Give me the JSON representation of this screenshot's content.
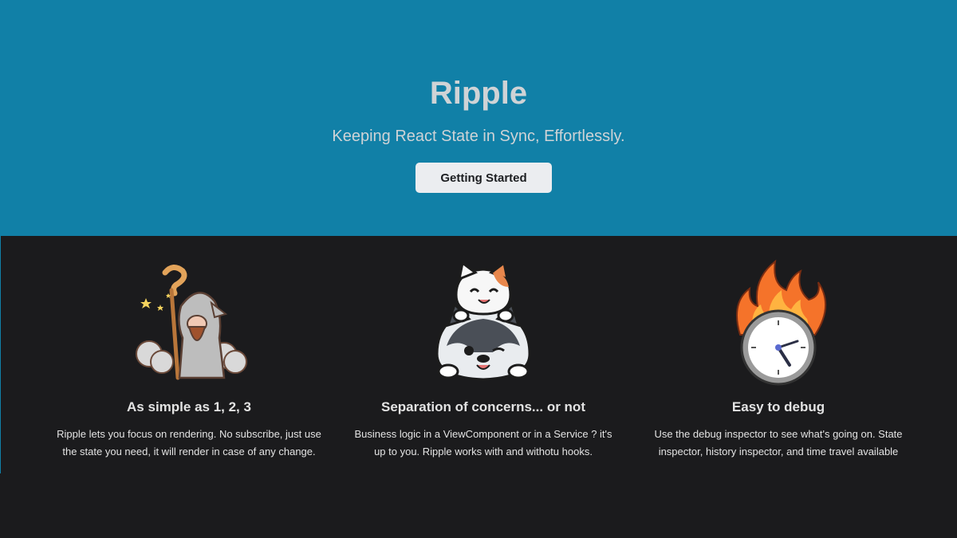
{
  "hero": {
    "title": "Ripple",
    "tagline": "Keeping React State in Sync, Effortlessly.",
    "cta_label": "Getting Started"
  },
  "features": [
    {
      "icon": "wizard-illustration",
      "title": "As simple as 1, 2, 3",
      "description": "Ripple lets you focus on rendering. No subscribe, just use the state you need, it will render in case of any change."
    },
    {
      "icon": "cat-and-husky-illustration",
      "title": "Separation of concerns... or not",
      "description": "Business logic in a ViewComponent or in a Service ? it's up to you. Ripple works with and withotu hooks."
    },
    {
      "icon": "flaming-clock-illustration",
      "title": "Easy to debug",
      "description": "Use the debug inspector to see what's going on. State inspector, history inspector, and time travel available"
    }
  ],
  "colors": {
    "hero_bg": "#1180a7",
    "page_bg": "#1b1b1d",
    "button_bg": "#ebedf0"
  }
}
